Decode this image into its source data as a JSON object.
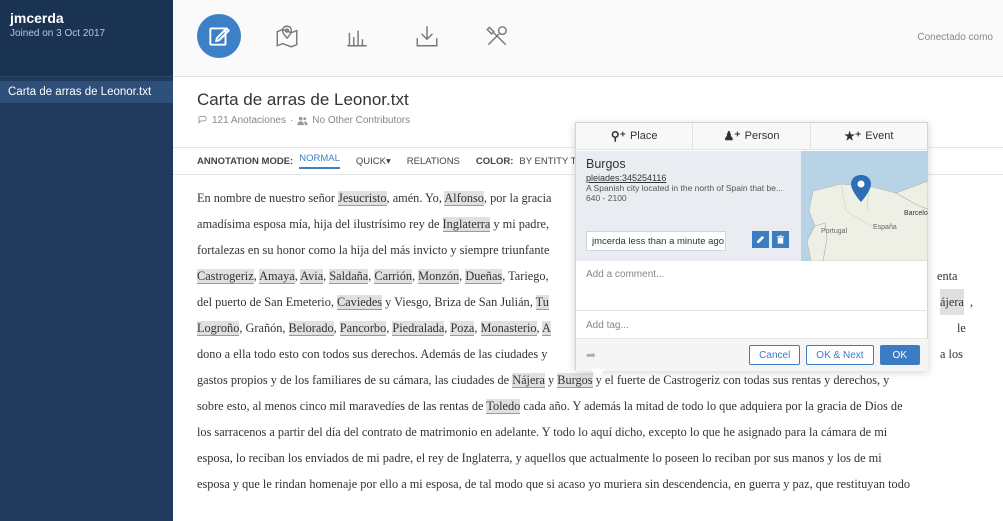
{
  "sidebar": {
    "user_name": "jmcerda",
    "joined": "Joined on 3 Oct 2017",
    "documents": [
      "Carta de arras de Leonor.txt"
    ]
  },
  "toolbar": {
    "status": "Conectado como",
    "icons": [
      "edit-icon",
      "map-icon",
      "chart-icon",
      "download-icon",
      "tools-icon"
    ]
  },
  "document": {
    "title": "Carta de arras de Leonor.txt",
    "annotations": "121 Anotaciones",
    "contributors": "No Other Contributors"
  },
  "mode_bar": {
    "label": "ANNOTATION MODE:",
    "normal": "NORMAL",
    "quick": "QUICK▾",
    "relations": "RELATIONS",
    "color_label": "COLOR:",
    "color_value": "BY ENTITY TY"
  },
  "text": {
    "l1a": "En nombre de nuestro señor ",
    "l1e1": "Jesucristo",
    "l1b": ", amén. Yo, ",
    "l1e2": "Alfonso",
    "l1c": ", por la gracia",
    "l2a": "amadísima esposa mía, hija del ilustrísimo rey de ",
    "l2e1": "Inglaterra",
    "l2b": " y mi padre,",
    "l3a": "fortalezas en su honor como la hija del más invicto y siempre triunfante",
    "l4e1": "Castrogeriz",
    "l4s1": ", ",
    "l4e2": "Amaya",
    "l4s2": ", ",
    "l4e3": "Avia",
    "l4s3": ", ",
    "l4e4": "Saldaña",
    "l4s4": ", ",
    "l4e5": "Carrión",
    "l4s5": ", ",
    "l4e6": "Monzón",
    "l4s6": ", ",
    "l4e7": "Dueñas",
    "l4s7": ", Tariego,",
    "l4tail": "enta",
    "l5a": "del puerto de San Emeterio, ",
    "l5e1": "Caviedes",
    "l5b": " y Viesgo, Briza de San Julián, ",
    "l5e2": "Tu",
    "l5tail": "ájera",
    "l5tail2": ",",
    "l6e1": "Logroño",
    "l6s1": ", Grañón, ",
    "l6e2": "Belorado",
    "l6s2": ", ",
    "l6e3": "Pancorbo",
    "l6s3": ", ",
    "l6e4": "Piedralada",
    "l6s4": ", ",
    "l6e5": "Poza",
    "l6s5": ", ",
    "l6e6": "Monasterio",
    "l6s6": ", ",
    "l6e7": "A",
    "l6tail": "le",
    "l7a": "dono a ella todo esto con todos sus derechos. Además de las ciudades y",
    "l7tail": "a los",
    "l8a": "gastos propios y de los familiares de su cámara, las ciudades de ",
    "l8e1": "Nájera",
    "l8b": " y ",
    "l8e2": "Burgos",
    "l8c": " y el fuerte de Castrogeriz con todas sus rentas y derechos, y",
    "l9a": "sobre esto, al menos cinco mil maravedíes de las rentas de ",
    "l9e1": "Toledo",
    "l9b": " cada año. Y además la mitad de todo lo que adquiera por la gracia de Dios de",
    "l10": "los sarracenos a partir del día del contrato de matrimonio en adelante. Y todo lo aquí dicho, excepto lo que he asignado para la cámara de mi",
    "l11": "esposa, lo reciban los enviados de mi padre, el rey de Inglaterra, y aquellos que actualmente lo poseen lo reciban por sus manos y los de mi",
    "l12": "esposa y que le rindan homenaje por ello a mi esposa, de tal modo que si acaso yo muriera sin descendencia, en guerra y paz, que restituyan todo"
  },
  "popup": {
    "tabs": {
      "place": "Place",
      "person": "Person",
      "event": "Event"
    },
    "card": {
      "title": "Burgos",
      "link": "pleiades:345254116",
      "description": "A Spanish city located in the north of Spain that be...",
      "dates": "640 - 2100",
      "user": "jmcerda",
      "time": "less than a minute ago"
    },
    "map": {
      "label_barcelona": "Barcelo",
      "label_espana": "España",
      "label_portugal": "Portugal"
    },
    "comment_placeholder": "Add a comment...",
    "tag_placeholder": "Add tag...",
    "buttons": {
      "cancel": "Cancel",
      "ok_next": "OK & Next",
      "ok": "OK"
    }
  }
}
